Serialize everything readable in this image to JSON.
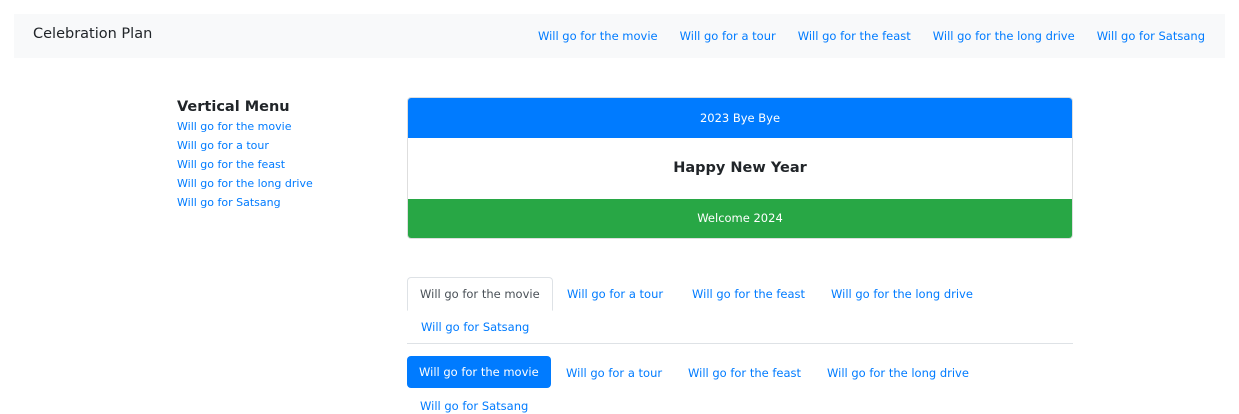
{
  "navbar": {
    "brand": "Celebration Plan",
    "links": [
      "Will go for the movie",
      "Will go for a tour",
      "Will go for the feast",
      "Will go for the long drive",
      "Will go for Satsang"
    ]
  },
  "vertical_menu": {
    "title": "Vertical Menu",
    "items": [
      "Will go for the movie",
      "Will go for a tour",
      "Will go for the feast",
      "Will go for the long drive",
      "Will go for Satsang"
    ]
  },
  "card": {
    "header": "2023 Bye Bye",
    "body": "Happy New Year",
    "footer": "Welcome 2024"
  },
  "tabs": {
    "items": [
      "Will go for the movie",
      "Will go for a tour",
      "Will go for the feast",
      "Will go for the long drive",
      "Will go for Satsang"
    ],
    "active": "Will go for the movie"
  },
  "pills": {
    "items": [
      "Will go for the movie",
      "Will go for a tour",
      "Will go for the feast",
      "Will go for the long drive",
      "Will go for Satsang"
    ],
    "active": "Will go for the movie"
  },
  "colors": {
    "primary": "#007bff",
    "success": "#28a745",
    "navbar_bg": "#f8f9fa"
  }
}
